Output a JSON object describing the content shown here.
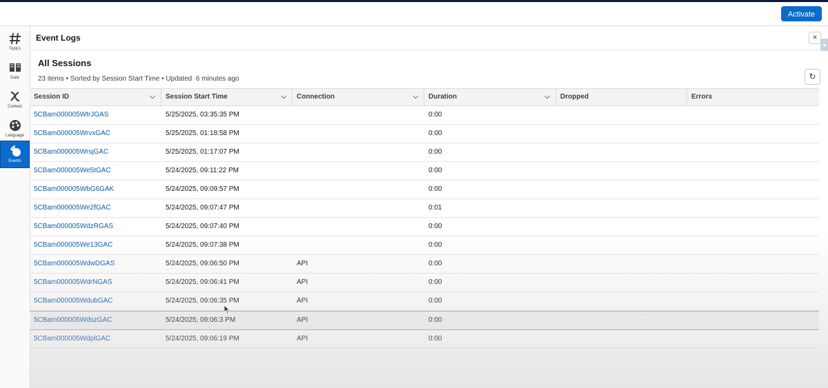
{
  "topbar": {
    "activate_label": "Activate"
  },
  "nav": {
    "items": [
      {
        "label": "Topics",
        "icon": "hash-icon"
      },
      {
        "label": "Data",
        "icon": "book-icon"
      },
      {
        "label": "Context",
        "icon": "variable-x-icon"
      },
      {
        "label": "Language",
        "icon": "palette-icon"
      },
      {
        "label": "Events",
        "icon": "events-icon",
        "active": true
      }
    ]
  },
  "panel": {
    "title": "Event Logs",
    "close_glyph": "×"
  },
  "list": {
    "title": "All Sessions",
    "meta": "23 items • Sorted by Session Start Time • Updated  6 minutes ago",
    "refresh_glyph": "↻"
  },
  "table": {
    "columns": [
      "Session ID",
      "Session Start Time",
      "Connection",
      "Duration",
      "Dropped",
      "Errors"
    ],
    "rows": [
      [
        "5CBam000005WtrJGAS",
        "5/25/2025, 03:35:35 PM",
        "",
        "0:00",
        "",
        ""
      ],
      [
        "5CBam000005WrvxGAC",
        "5/25/2025, 01:18:58 PM",
        "",
        "0:00",
        "",
        ""
      ],
      [
        "5CBam000005WrsjGAC",
        "5/25/2025, 01:17:07 PM",
        "",
        "0:00",
        "",
        ""
      ],
      [
        "5CBam000005We5tGAC",
        "5/24/2025, 09:11:22 PM",
        "",
        "0:00",
        "",
        ""
      ],
      [
        "5CBam000005WbG6GAK",
        "5/24/2025, 09:09:57 PM",
        "",
        "0:00",
        "",
        ""
      ],
      [
        "5CBam000005We2fGAC",
        "5/24/2025, 09:07:47 PM",
        "",
        "0:01",
        "",
        ""
      ],
      [
        "5CBam000005WdzRGAS",
        "5/24/2025, 09:07:40 PM",
        "",
        "0:00",
        "",
        ""
      ],
      [
        "5CBam000005We13GAC",
        "5/24/2025, 09:07:38 PM",
        "",
        "0:00",
        "",
        ""
      ],
      [
        "5CBam000005WdwDGAS",
        "5/24/2025, 09:06:50 PM",
        "API",
        "0:00",
        "",
        ""
      ],
      [
        "5CBam000005WdrNGAS",
        "5/24/2025, 09:06:41 PM",
        "API",
        "0:00",
        "",
        ""
      ],
      [
        "5CBam000005WdubGAC",
        "5/24/2025, 09:06:35 PM",
        "API",
        "0:00",
        "",
        ""
      ],
      [
        "5CBam000005WdszGAC",
        "5/24/2025, 09:06:3 PM",
        "API",
        "0:00",
        "",
        ""
      ],
      [
        "5CBam000005WdplGAC",
        "5/24/2025, 09:06:19 PM",
        "API",
        "0:00",
        "",
        ""
      ]
    ],
    "hover_row": 11
  },
  "colors": {
    "accent": "#0b6bcb",
    "link": "#0b5cab"
  }
}
